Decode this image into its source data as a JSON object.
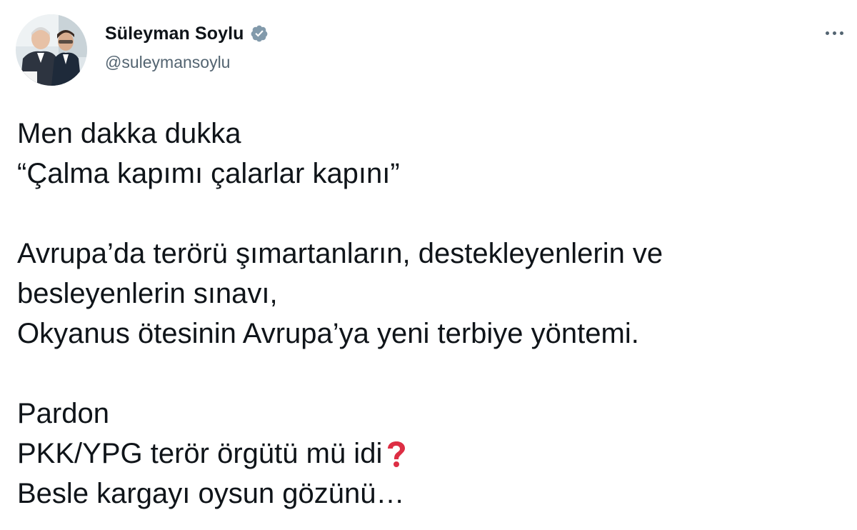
{
  "author": {
    "display_name": "Süleyman Soylu",
    "handle": "@suleymansoylu",
    "verified": true,
    "avatar_icon": "profile-photo"
  },
  "menu_icon": "more-options-icon",
  "tweet": {
    "lines": [
      "Men dakka dukka",
      "“Çalma kapımı çalarlar kapını”",
      "",
      "Avrupa’da terörü şımartanların, destekleyenlerin ve",
      "besleyenlerin sınavı,",
      "Okyanus ötesinin Avrupa’ya yeni terbiye yöntemi.",
      "",
      "Pardon",
      "PKK/YPG terör örgütü mü idi",
      "Besle kargayı oysun gözünü…"
    ],
    "emoji": "red-question-mark-icon"
  },
  "colors": {
    "text": "#0f1419",
    "secondary": "#536471",
    "verified_badge": "#829aab",
    "question_mark": "#dd2e44"
  }
}
